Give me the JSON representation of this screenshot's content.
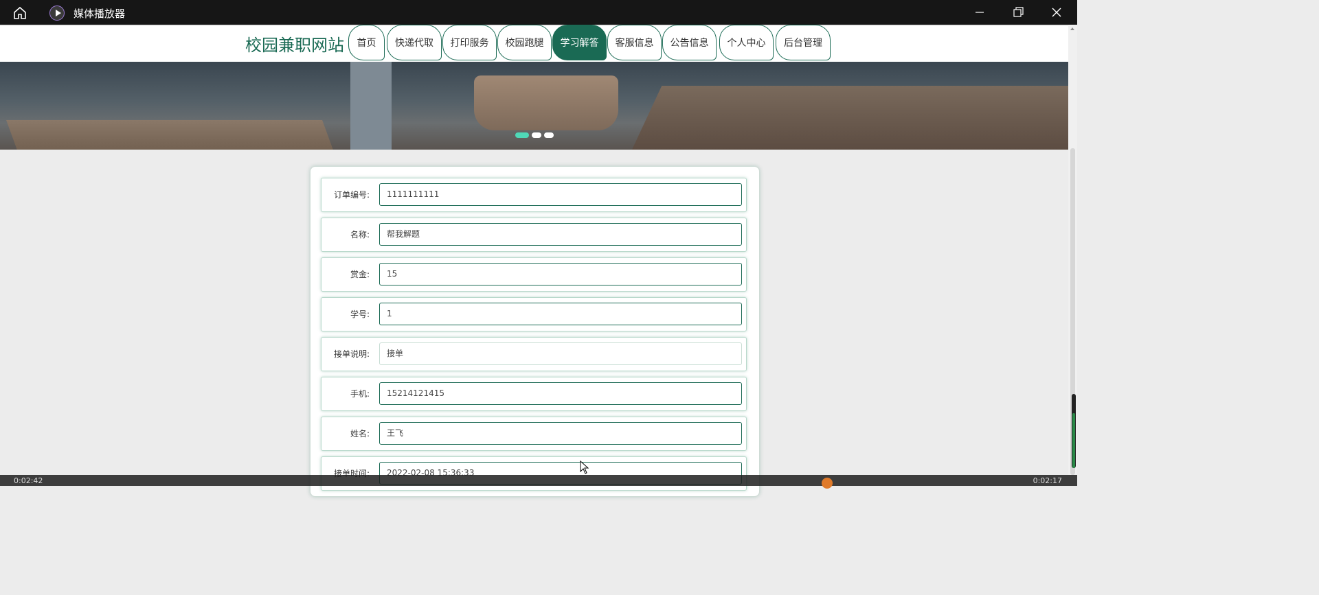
{
  "window": {
    "title": "媒体播放器"
  },
  "site": {
    "name": "校园兼职网站",
    "nav": [
      {
        "label": "首页",
        "active": false
      },
      {
        "label": "快递代取",
        "active": false
      },
      {
        "label": "打印服务",
        "active": false
      },
      {
        "label": "校园跑腿",
        "active": false
      },
      {
        "label": "学习解答",
        "active": true
      },
      {
        "label": "客服信息",
        "active": false
      },
      {
        "label": "公告信息",
        "active": false
      },
      {
        "label": "个人中心",
        "active": false
      },
      {
        "label": "后台管理",
        "active": false
      }
    ]
  },
  "banner": {
    "slide_count": 3,
    "active_slide": 1
  },
  "form": {
    "fields": [
      {
        "label": "订单编号:",
        "value": "1111111111"
      },
      {
        "label": "名称:",
        "value": "帮我解题"
      },
      {
        "label": "赏金:",
        "value": "15"
      },
      {
        "label": "学号:",
        "value": "1"
      },
      {
        "label": "接单说明:",
        "value": "接单"
      },
      {
        "label": "手机:",
        "value": "15214121415"
      },
      {
        "label": "姓名:",
        "value": "王飞"
      },
      {
        "label": "接单时间:",
        "value": "2022-02-08 15:36:33"
      }
    ]
  },
  "player": {
    "elapsed": "0:02:42",
    "remaining": "0:02:17"
  },
  "colors": {
    "accent": "#1a6a54",
    "dot_active": "#4fd8b8",
    "titlebar": "#161616"
  }
}
